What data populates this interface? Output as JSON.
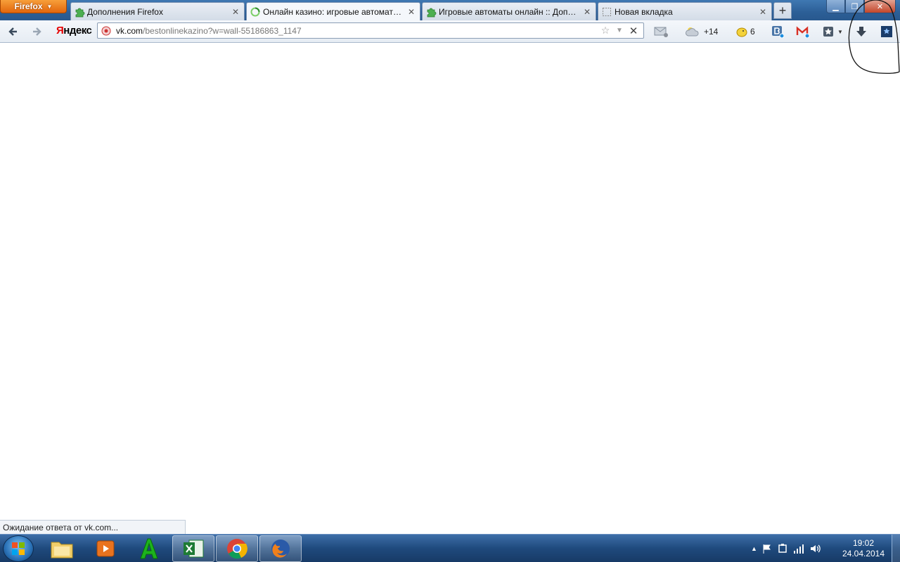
{
  "browser": {
    "menu_button": "Firefox",
    "tabs": [
      {
        "label": "Дополнения Firefox",
        "icon": "puzzle-icon"
      },
      {
        "label": "Онлайн казино: игровые автоматы ...",
        "icon": "loading-spinner-icon"
      },
      {
        "label": "Игровые автоматы онлайн :: Допол...",
        "icon": "puzzle-icon"
      },
      {
        "label": "Новая вкладка",
        "icon": "blank-page-icon"
      }
    ],
    "new_tab": "+"
  },
  "toolbar": {
    "yandex_logo_y": "Я",
    "yandex_logo_rest": "ндекс",
    "url_host": "vk.com",
    "url_path": "/bestonlinekazino?w=wall-55186863_1147",
    "weather_text": "+14",
    "counter_text": "6"
  },
  "status": {
    "text": "Ожидание ответа от vk.com..."
  },
  "taskbar": {
    "time": "19:02",
    "date": "24.04.2014"
  }
}
